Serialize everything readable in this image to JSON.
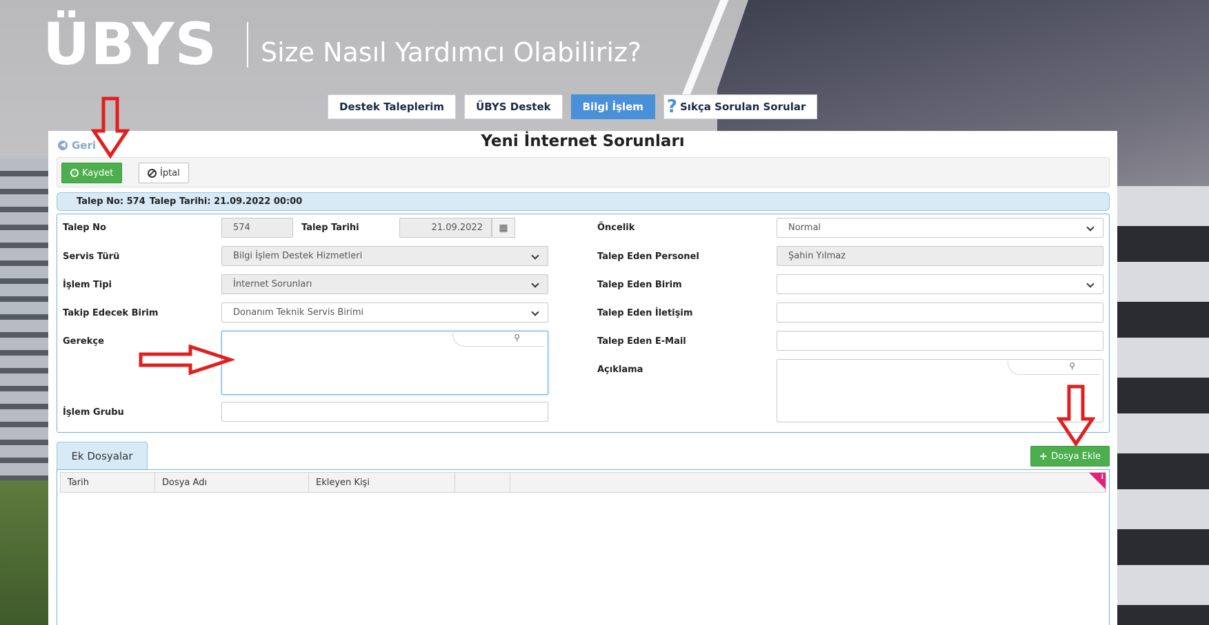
{
  "header": {
    "brand": "ÜBYS",
    "tagline": "Size Nasıl Yardımcı Olabiliriz?"
  },
  "nav": {
    "tabs": [
      {
        "label": "Destek Taleplerim"
      },
      {
        "label": "ÜBYS Destek"
      },
      {
        "label": "Bilgi İşlem",
        "active": true
      },
      {
        "label": "Sıkça Sorulan Sorular",
        "icon": "question-icon"
      }
    ]
  },
  "page": {
    "back_label": "Geri",
    "title": "Yeni İnternet Sorunları"
  },
  "toolbar": {
    "save_label": "Kaydet",
    "cancel_label": "İptal"
  },
  "info_bar": {
    "talep_no_text": "Talep No: 574",
    "talep_tarihi_text": "Talep Tarihi: 21.09.2022 00:00"
  },
  "form": {
    "talep_no": {
      "label": "Talep No",
      "value": "574"
    },
    "talep_tarihi": {
      "label": "Talep Tarihi",
      "value": "21.09.2022"
    },
    "servis_turu": {
      "label": "Servis Türü",
      "value": "Bilgi İşlem Destek Hizmetleri"
    },
    "islem_tipi": {
      "label": "İşlem Tipi",
      "value": "İnternet Sorunları"
    },
    "takip_edecek_birim": {
      "label": "Takip Edecek Birim",
      "value": "Donanım Teknik Servis Birimi"
    },
    "gerekce": {
      "label": "Gerekçe",
      "value": ""
    },
    "islem_grubu": {
      "label": "İşlem Grubu",
      "value": ""
    },
    "oncelik": {
      "label": "Öncelik",
      "value": "Normal"
    },
    "talep_eden_personel": {
      "label": "Talep Eden Personel",
      "value": "Şahin Yılmaz"
    },
    "talep_eden_birim": {
      "label": "Talep Eden Birim",
      "value": ""
    },
    "talep_eden_iletisim": {
      "label": "Talep Eden İletişim",
      "value": ""
    },
    "talep_eden_email": {
      "label": "Talep Eden E-Mail",
      "value": ""
    },
    "aciklama": {
      "label": "Açıklama",
      "value": ""
    }
  },
  "attachments": {
    "tab_label": "Ek Dosyalar",
    "add_label": "Dosya Ekle",
    "columns": [
      "Tarih",
      "Dosya Adı",
      "Ekleyen Kişi",
      "",
      ""
    ],
    "rows": []
  },
  "colors": {
    "accent_blue": "#4a90d9",
    "success_green": "#4cae4c",
    "annotation_red": "#e02020"
  }
}
